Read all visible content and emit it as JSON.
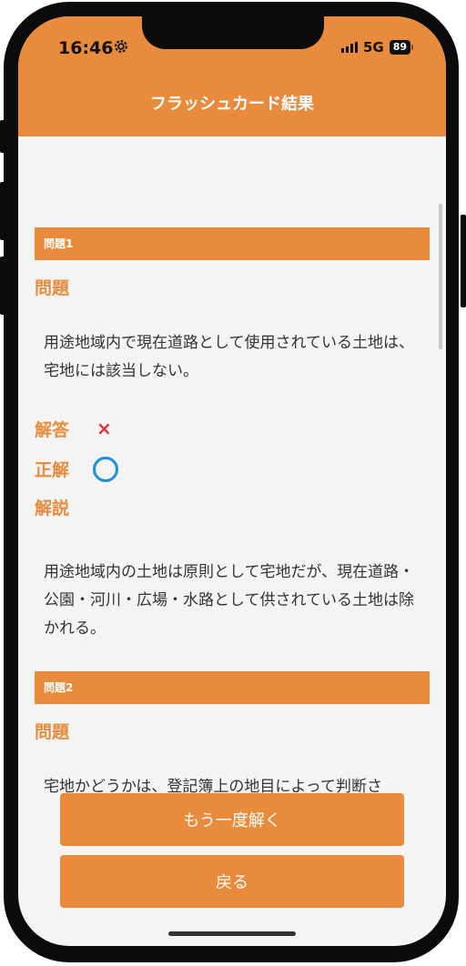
{
  "status_bar": {
    "time": "16:46",
    "network": "5G",
    "battery": "89"
  },
  "header": {
    "title": "フラッシュカード結果"
  },
  "questions": [
    {
      "header": "問題1",
      "question_label": "問題",
      "question_text": "用途地域内で現在道路として使用されている土地は、宅地には該当しない。",
      "answer_label": "解答",
      "answer_mark": "×",
      "correct_label": "正解",
      "explanation_label": "解説",
      "explanation_text": "用途地域内の土地は原則として宅地だが、現在道路・公園・河川・広場・水路として供されている土地は除かれる。"
    },
    {
      "header": "問題2",
      "question_label": "問題",
      "question_text": "宅地かどうかは、登記簿上の地目によって判断さ"
    }
  ],
  "buttons": {
    "retry": "もう一度解く",
    "back": "戻る"
  },
  "colors": {
    "accent": "#e98b3c",
    "wrong": "#e0303a",
    "correct": "#1e8ee0"
  }
}
